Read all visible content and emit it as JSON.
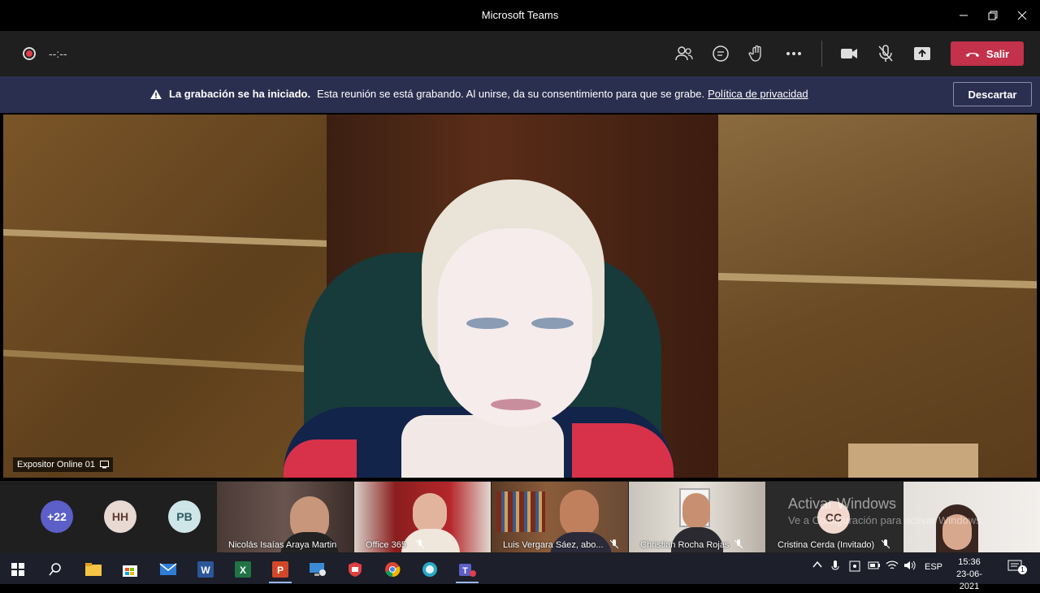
{
  "window": {
    "title": "Microsoft Teams"
  },
  "toolbar": {
    "timer": "--:--",
    "leave_label": "Salir"
  },
  "banner": {
    "bold_text": "La grabación se ha iniciado.",
    "text": "Esta reunión se está grabando. Al unirse, da su consentimiento para que se grabe.",
    "link_text": "Política de privacidad",
    "dismiss_label": "Descartar"
  },
  "stage": {
    "presenter_name": "Expositor Online 01"
  },
  "strip": {
    "avatars": [
      {
        "label": "+22",
        "color": "#5b5fc7",
        "text_color": "#ffffff"
      },
      {
        "label": "HH",
        "color": "#e8d9d3",
        "text_color": "#5a3a30"
      },
      {
        "label": "PB",
        "color": "#cfe6e8",
        "text_color": "#2d5a60"
      }
    ],
    "tiles": [
      {
        "name": "Nicolás Isaías Araya Martin"
      },
      {
        "name": "Office 365"
      },
      {
        "name": "Luis Vergara Sáez, abo..."
      },
      {
        "name": "Christian Rocha Rojas"
      },
      {
        "name": "Cristina Cerda (Invitado)",
        "initials": "CC"
      },
      {
        "name": ""
      }
    ]
  },
  "watermark": {
    "line1": "Activar Windows",
    "line2": "Ve a Configuración para activar Windows."
  },
  "taskbar": {
    "language": "ESP",
    "time": "15:36",
    "date": "23-06-2021",
    "notification_count": "1"
  },
  "colors": {
    "leave": "#c4314b",
    "banner": "#2b2f4f",
    "toolbar": "#1f1f1f"
  }
}
